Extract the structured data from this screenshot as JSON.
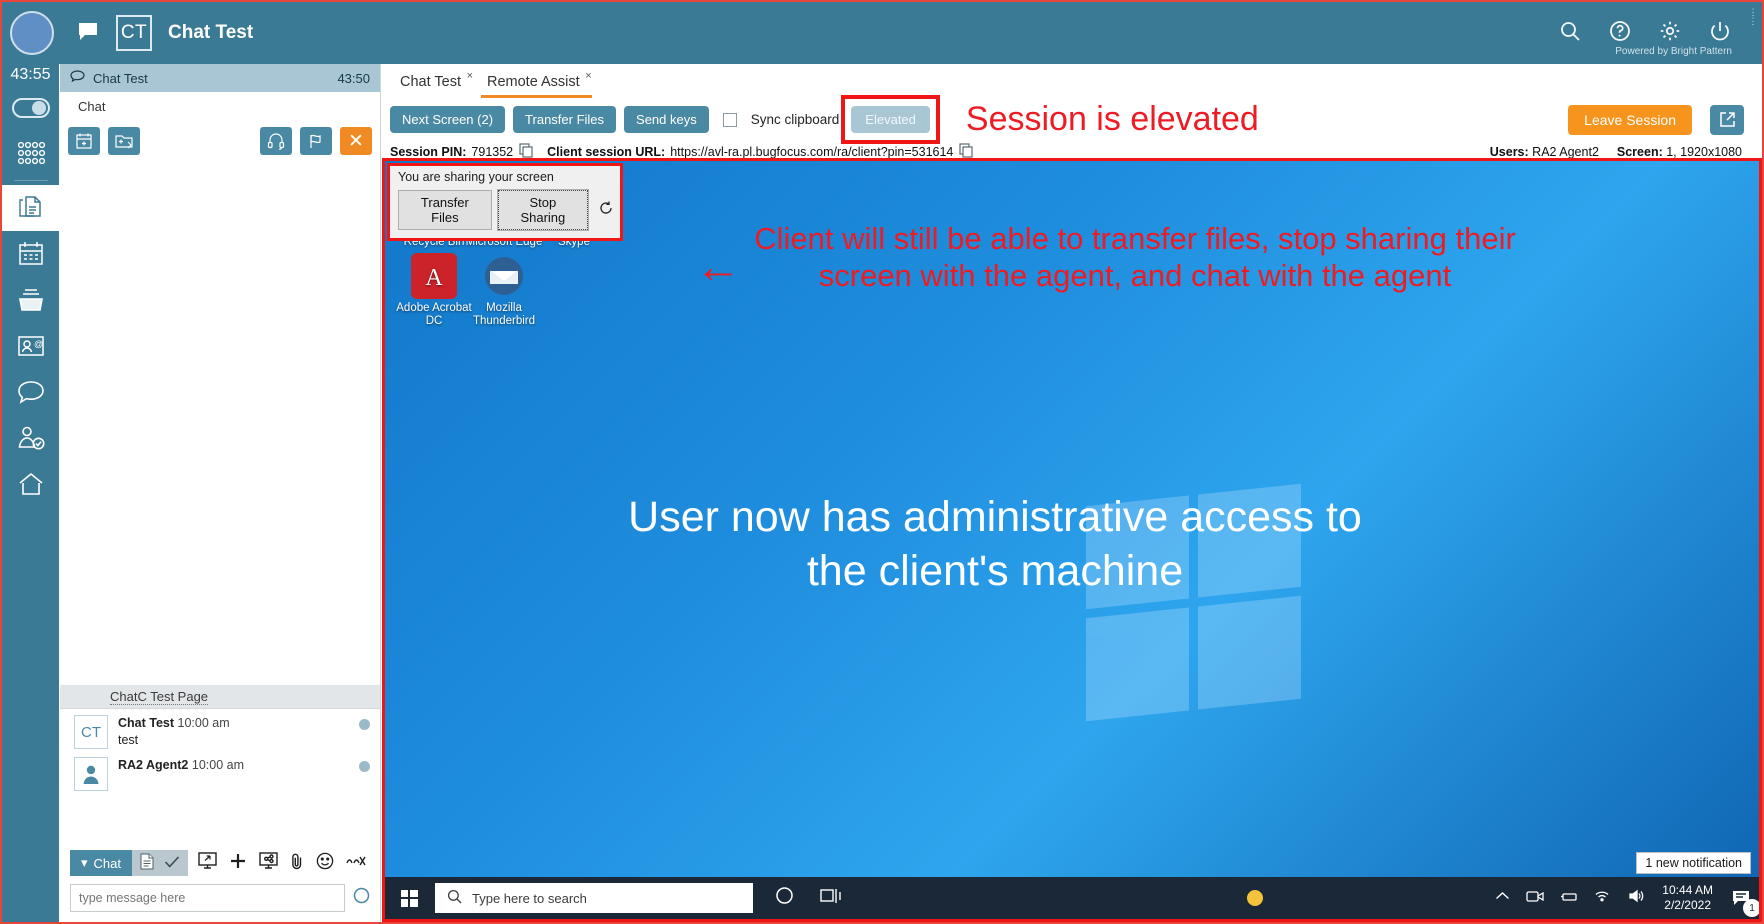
{
  "topbar": {
    "title": "Chat Test",
    "initials": "CT",
    "chat_icon": "chat-bubble-icon",
    "search_icon": "search-icon",
    "help_icon": "help-icon",
    "settings_icon": "gear-icon",
    "power_icon": "power-icon",
    "powered_by": "Powered by Bright Pattern",
    "accent": "#3b7a94"
  },
  "rail": {
    "timer": "43:55",
    "items": [
      {
        "name": "apps-grid",
        "label": "Apps"
      },
      {
        "name": "cases",
        "label": "Cases"
      },
      {
        "name": "calendar",
        "label": "Calendar"
      },
      {
        "name": "inbox",
        "label": "Inbox"
      },
      {
        "name": "contacts",
        "label": "Contacts"
      },
      {
        "name": "chat",
        "label": "Chat"
      },
      {
        "name": "agent-status",
        "label": "Agents"
      },
      {
        "name": "home",
        "label": "Home"
      }
    ]
  },
  "chat_panel": {
    "header_title": "Chat Test",
    "header_timer": "43:50",
    "sub_label": "Chat",
    "tools": [
      {
        "name": "schedule-button",
        "icon": "calendar-plus-icon"
      },
      {
        "name": "new-case-button",
        "icon": "folder-plus-icon"
      },
      {
        "name": "consult-button",
        "icon": "headset-icon"
      },
      {
        "name": "flag-button",
        "icon": "flag-icon"
      },
      {
        "name": "end-chat-button",
        "icon": "close-icon",
        "label": "✕"
      }
    ],
    "page_header": "ChatC Test Page",
    "messages": [
      {
        "avatar": "CT",
        "author": "Chat Test",
        "time": "10:00 am",
        "text": "test"
      },
      {
        "avatar": "person-icon",
        "author": "RA2 Agent2",
        "time": "10:00 am",
        "text": ""
      }
    ],
    "footer": {
      "mode_label": "Chat",
      "doc_icon": "document-icon",
      "check_icon": "check-icon",
      "icons": [
        {
          "name": "screen-share-icon"
        },
        {
          "name": "plus-icon"
        },
        {
          "name": "share-screen-icon"
        },
        {
          "name": "attachment-icon"
        },
        {
          "name": "emoji-icon"
        },
        {
          "name": "mute-icon"
        }
      ],
      "input_placeholder": "type message here",
      "input_value": "",
      "mic_icon": "mic-icon"
    }
  },
  "main": {
    "tabs": [
      {
        "label": "Chat Test",
        "active": false,
        "close": "×"
      },
      {
        "label": "Remote Assist",
        "active": true,
        "close": "×"
      }
    ],
    "toolbar": {
      "next_screen": "Next Screen (2)",
      "transfer_files": "Transfer Files",
      "send_keys": "Send keys",
      "sync_clipboard": "Sync clipboard",
      "sync_clipboard_checked": false,
      "elevated": "Elevated",
      "leave_session": "Leave Session",
      "popout_icon": "popout-icon",
      "highlight_color": "#f01616"
    },
    "info": {
      "pin_label": "Session PIN:",
      "pin_value": "791352",
      "copy_icon": "copy-icon",
      "url_label": "Client session URL:",
      "url_value": "https://avl-ra.pl.bugfocus.com/ra/client?pin=531614",
      "users_label": "Users:",
      "users_value": "RA2 Agent2",
      "screen_label": "Screen:",
      "screen_value": "1, 1920x1080"
    },
    "annotations": {
      "elevated_note": "Session is elevated",
      "arrow": "←",
      "top_note": "Client will still be able to transfer files, stop sharing their screen with the agent, and chat with the agent",
      "mid_note": "User now has administrative access to the client's machine"
    }
  },
  "remote_screen": {
    "share_bar": {
      "title": "You are sharing your screen",
      "transfer_files": "Transfer Files",
      "stop_sharing": "Stop Sharing",
      "refresh_icon": "loop-icon"
    },
    "desktop_icons": [
      {
        "label": "Recycle Bin",
        "icon": "recycle-bin-icon"
      },
      {
        "label": "Microsoft Edge",
        "icon": "edge-icon"
      },
      {
        "label": "Skype",
        "icon": "skype-icon"
      },
      {
        "label": "Adobe Acrobat DC",
        "icon": "acrobat-icon"
      },
      {
        "label": "Mozilla Thunderbird",
        "icon": "thunderbird-icon"
      }
    ],
    "taskbar": {
      "start_icon": "windows-start-icon",
      "search_placeholder": "Type here to search",
      "search_icon": "search-icon",
      "cortana_icon": "cortana-circle-icon",
      "taskview_icon": "task-view-icon",
      "chevron_icon": "chevron-up-icon",
      "tray_icons": [
        "camera-icon",
        "usb-icon",
        "wifi-icon",
        "volume-icon"
      ],
      "time": "10:44 AM",
      "date": "2/2/2022",
      "notification_tooltip": "1 new notification",
      "notification_count": "1"
    }
  }
}
